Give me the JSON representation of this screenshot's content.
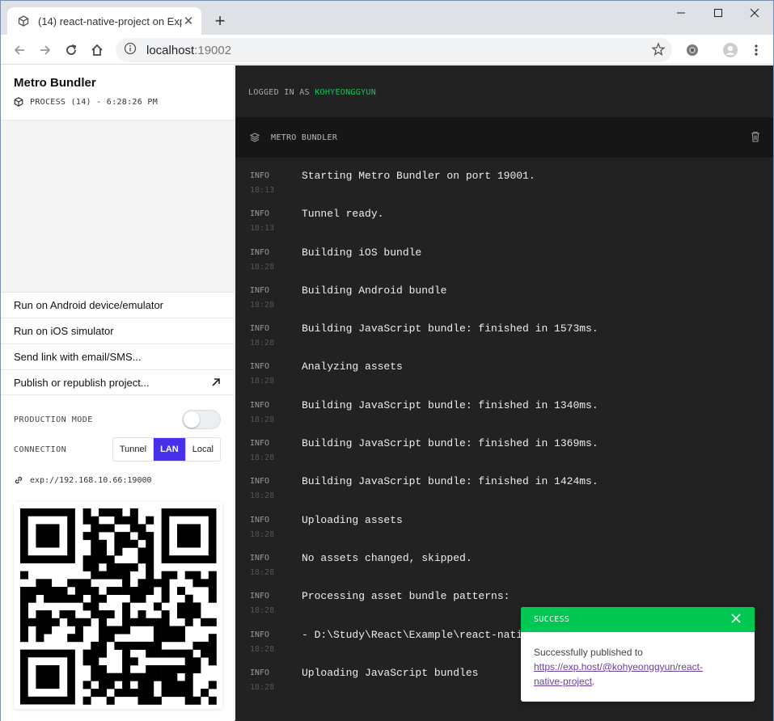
{
  "browser": {
    "tab_title": "(14) react-native-project on Exp",
    "new_tab": "+",
    "url_host": "localhost",
    "url_port": ":19002"
  },
  "sidebar": {
    "title": "Metro Bundler",
    "process": "PROCESS (14) - 6:28:26 PM",
    "actions": [
      {
        "label": "Run on Android device/emulator"
      },
      {
        "label": "Run on iOS simulator"
      },
      {
        "label": "Send link with email/SMS..."
      },
      {
        "label": "Publish or republish project..."
      }
    ],
    "production_mode_label": "PRODUCTION MODE",
    "production_mode_on": false,
    "connection_label": "CONNECTION",
    "connection_options": [
      "Tunnel",
      "LAN",
      "Local"
    ],
    "connection_selected": "LAN",
    "exp_url": "exp://192.168.10.66:19000"
  },
  "main": {
    "logged_in_prefix": "LOGGED IN AS",
    "username": "KOHYEONGGYUN",
    "panel_title": "METRO BUNDLER",
    "logs": [
      {
        "level": "INFO",
        "time": "18:13",
        "message": "Starting Metro Bundler on port 19001."
      },
      {
        "level": "INFO",
        "time": "18:13",
        "message": "Tunnel ready."
      },
      {
        "level": "INFO",
        "time": "18:28",
        "message": "Building iOS bundle"
      },
      {
        "level": "INFO",
        "time": "18:28",
        "message": "Building Android bundle"
      },
      {
        "level": "INFO",
        "time": "18:28",
        "message": "Building JavaScript bundle: finished in 1573ms."
      },
      {
        "level": "INFO",
        "time": "18:28",
        "message": "Analyzing assets"
      },
      {
        "level": "INFO",
        "time": "18:28",
        "message": "Building JavaScript bundle: finished in 1340ms."
      },
      {
        "level": "INFO",
        "time": "18:28",
        "message": "Building JavaScript bundle: finished in 1369ms."
      },
      {
        "level": "INFO",
        "time": "18:28",
        "message": "Building JavaScript bundle: finished in 1424ms."
      },
      {
        "level": "INFO",
        "time": "18:28",
        "message": "Uploading assets"
      },
      {
        "level": "INFO",
        "time": "18:28",
        "message": "No assets changed, skipped."
      },
      {
        "level": "INFO",
        "time": "18:28",
        "message": "Processing asset bundle patterns:"
      },
      {
        "level": "INFO",
        "time": "18:28",
        "message": "- D:\\Study\\React\\Example\\react-nati"
      },
      {
        "level": "INFO",
        "time": "18:28",
        "message": "Uploading JavaScript bundles"
      }
    ]
  },
  "toast": {
    "header": "SUCCESS",
    "text": "Successfully published to",
    "link_line1": "https://exp.host/@kohyeonggyun/react-",
    "link_line2": "native-project",
    "trailing": "."
  },
  "colors": {
    "accent": "#4630eb",
    "success": "#00c853",
    "username": "#19c35e",
    "log_bg": "#222222"
  }
}
